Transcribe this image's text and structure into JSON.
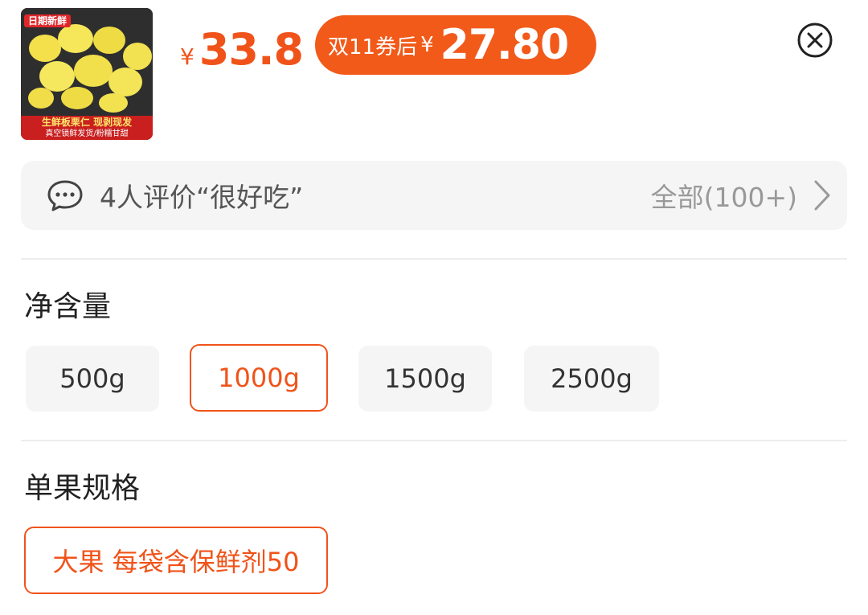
{
  "product": {
    "thumb_tag": "日期新鲜",
    "thumb_banner_main": "生鲜板栗仁 现剥现发",
    "thumb_banner_sub": "真空锁鲜发货/粉糯甘甜",
    "currency": "¥",
    "price": "33.8",
    "promo_label": "双11券后",
    "promo_currency": "¥",
    "promo_price": "27.80"
  },
  "close_icon": "close-circle-icon",
  "review": {
    "icon": "chat-bubble-icon",
    "text": "4人评价“很好吃”",
    "all_label": "全部(100+)",
    "chevron_icon": "chevron-right-icon"
  },
  "net_content": {
    "title": "净含量",
    "options": [
      "500g",
      "1000g",
      "1500g",
      "2500g"
    ],
    "selected": "1000g"
  },
  "spec": {
    "title": "单果规格",
    "options": [
      "大果 每袋含保鲜剂50"
    ],
    "selected": "大果 每袋含保鲜剂50"
  },
  "colors": {
    "accent": "#f0531a",
    "promo_bg": "#f25a1a",
    "option_bg": "#f5f5f5"
  }
}
